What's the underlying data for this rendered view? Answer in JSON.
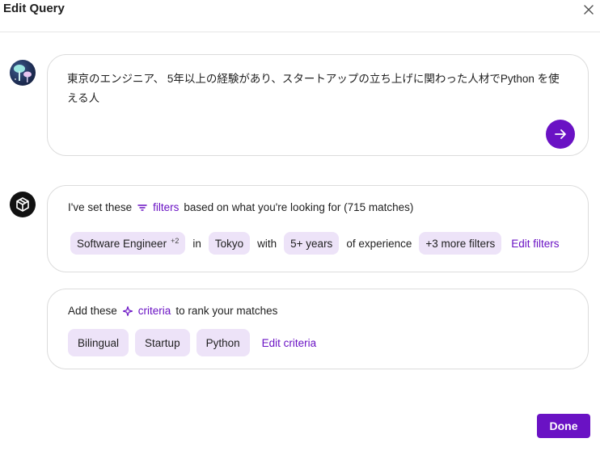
{
  "header": {
    "title": "Edit Query"
  },
  "query": {
    "text": "東京のエンジニア、 5年以上の経験があり、スタートアップの立ち上げに関わった人材でPython を使える人"
  },
  "filters": {
    "intro_before": "I've set these",
    "intro_link": "filters",
    "intro_after": "based on what you're looking for (715 matches)",
    "role": "Software Engineer",
    "role_more": "+2",
    "conn_in": "in",
    "location": "Tokyo",
    "conn_with": "with",
    "experience": "5+ years",
    "conn_of": "of experience",
    "more": "+3 more filters",
    "edit": "Edit filters"
  },
  "criteria": {
    "intro_before": "Add these",
    "intro_link": "criteria",
    "intro_after": "to rank your matches",
    "items": [
      "Bilingual",
      "Startup",
      "Python"
    ],
    "edit": "Edit criteria"
  },
  "footer": {
    "done": "Done"
  },
  "colors": {
    "accent": "#6a12c4",
    "chip_bg": "#ede3f8"
  }
}
